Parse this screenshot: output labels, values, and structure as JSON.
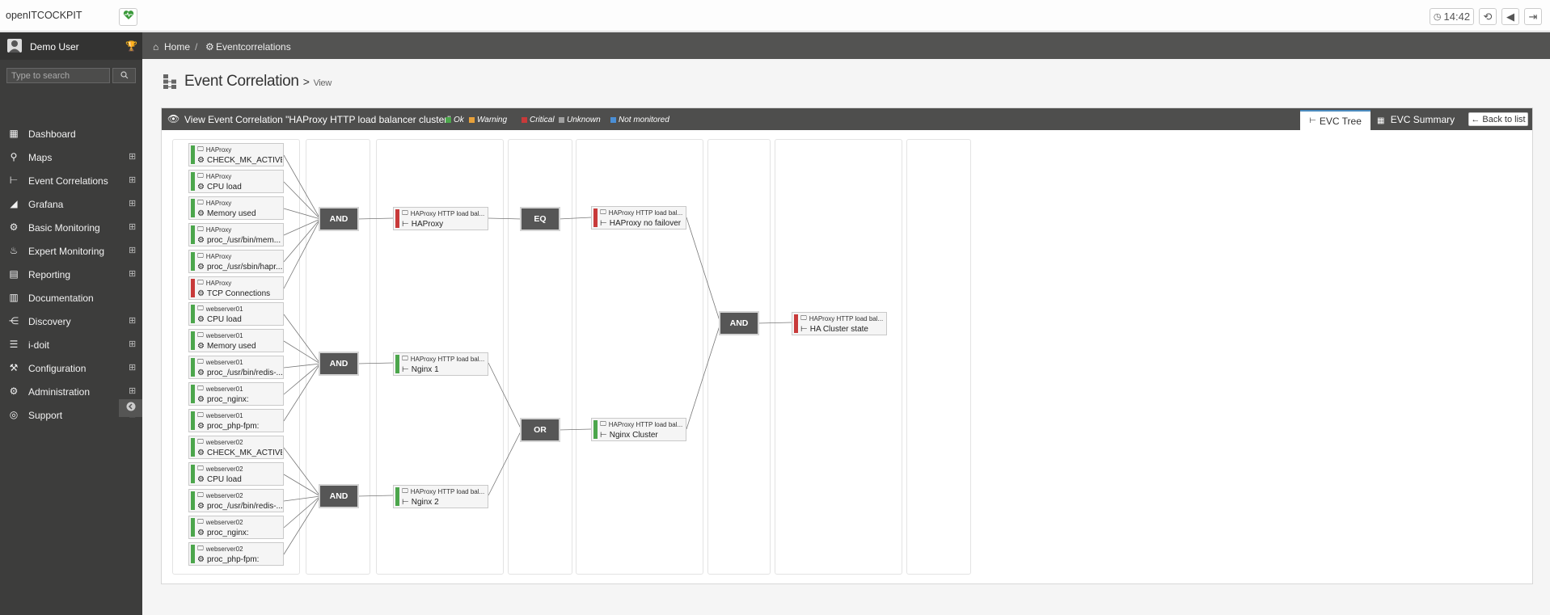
{
  "app": {
    "brand": "openITCOCKPIT",
    "time": "14:42"
  },
  "colors": {
    "ok": "#4ca64c",
    "warning": "#e8a13a",
    "critical": "#c83a3a",
    "unknown": "#a0a0a0",
    "not_monitored": "#4a8fd6"
  },
  "sidebar": {
    "user": "Demo User",
    "search_placeholder": "Type to search",
    "items": [
      {
        "label": "Dashboard",
        "icon": "dashboard-icon",
        "expand": false
      },
      {
        "label": "Maps",
        "icon": "map-marker-icon",
        "expand": true
      },
      {
        "label": "Event Correlations",
        "icon": "sitemap-icon",
        "expand": true
      },
      {
        "label": "Grafana",
        "icon": "area-chart-icon",
        "expand": true
      },
      {
        "label": "Basic Monitoring",
        "icon": "cogs-icon",
        "expand": true
      },
      {
        "label": "Expert Monitoring",
        "icon": "fire-icon",
        "expand": true
      },
      {
        "label": "Reporting",
        "icon": "file-icon",
        "expand": true
      },
      {
        "label": "Documentation",
        "icon": "book-icon",
        "expand": false
      },
      {
        "label": "Discovery",
        "icon": "share-icon",
        "expand": true
      },
      {
        "label": "i-doit",
        "icon": "database-icon",
        "expand": true
      },
      {
        "label": "Configuration",
        "icon": "wrench-icon",
        "expand": true
      },
      {
        "label": "Administration",
        "icon": "gears-icon",
        "expand": true
      },
      {
        "label": "Support",
        "icon": "life-ring-icon",
        "expand": true
      }
    ]
  },
  "breadcrumb": {
    "home": "Home",
    "current": "Eventcorrelations"
  },
  "page": {
    "title": "Event Correlation",
    "sub_sep": ">",
    "subtitle": "View"
  },
  "panel": {
    "title": "View Event Correlation \"HAProxy HTTP load balancer cluster\"",
    "legend": [
      {
        "label": "Ok",
        "color": "#4ca64c"
      },
      {
        "label": "Warning",
        "color": "#e8a13a"
      },
      {
        "label": "Critical",
        "color": "#c83a3a"
      },
      {
        "label": "Unknown",
        "color": "#a0a0a0"
      },
      {
        "label": "Not monitored",
        "color": "#4a8fd6"
      }
    ],
    "tab_tree": "EVC Tree",
    "tab_summary": "EVC Summary",
    "back": "Back to list"
  },
  "services": [
    {
      "host": "HAProxy",
      "service": "CHECK_MK_ACTIVE",
      "state": "ok"
    },
    {
      "host": "HAProxy",
      "service": "CPU load",
      "state": "ok"
    },
    {
      "host": "HAProxy",
      "service": "Memory used",
      "state": "ok"
    },
    {
      "host": "HAProxy",
      "service": "proc_/usr/bin/mem...",
      "state": "ok"
    },
    {
      "host": "HAProxy",
      "service": "proc_/usr/sbin/hapr...",
      "state": "ok"
    },
    {
      "host": "HAProxy",
      "service": "TCP Connections",
      "state": "critical"
    },
    {
      "host": "webserver01",
      "service": "CPU load",
      "state": "ok"
    },
    {
      "host": "webserver01",
      "service": "Memory used",
      "state": "ok"
    },
    {
      "host": "webserver01",
      "service": "proc_/usr/bin/redis-...",
      "state": "ok"
    },
    {
      "host": "webserver01",
      "service": "proc_nginx:",
      "state": "ok"
    },
    {
      "host": "webserver01",
      "service": "proc_php-fpm:",
      "state": "ok"
    },
    {
      "host": "webserver02",
      "service": "CHECK_MK_ACTIVE",
      "state": "ok"
    },
    {
      "host": "webserver02",
      "service": "CPU load",
      "state": "ok"
    },
    {
      "host": "webserver02",
      "service": "proc_/usr/bin/redis-...",
      "state": "ok"
    },
    {
      "host": "webserver02",
      "service": "proc_nginx:",
      "state": "ok"
    },
    {
      "host": "webserver02",
      "service": "proc_php-fpm:",
      "state": "ok"
    }
  ],
  "operators": {
    "l1_a": "AND",
    "l1_b": "AND",
    "l1_c": "AND",
    "l2_eq": "EQ",
    "l2_or": "OR",
    "l3_and": "AND"
  },
  "vservices": [
    {
      "host": "HAProxy HTTP load bal...",
      "service": "HAProxy",
      "state": "critical"
    },
    {
      "host": "HAProxy HTTP load bal...",
      "service": "Nginx 1",
      "state": "ok"
    },
    {
      "host": "HAProxy HTTP load bal...",
      "service": "Nginx 2",
      "state": "ok"
    },
    {
      "host": "HAProxy HTTP load bal...",
      "service": "HAProxy no failover",
      "state": "critical"
    },
    {
      "host": "HAProxy HTTP load bal...",
      "service": "Nginx Cluster",
      "state": "ok"
    },
    {
      "host": "HAProxy HTTP load bal...",
      "service": "HA Cluster state",
      "state": "critical"
    }
  ]
}
